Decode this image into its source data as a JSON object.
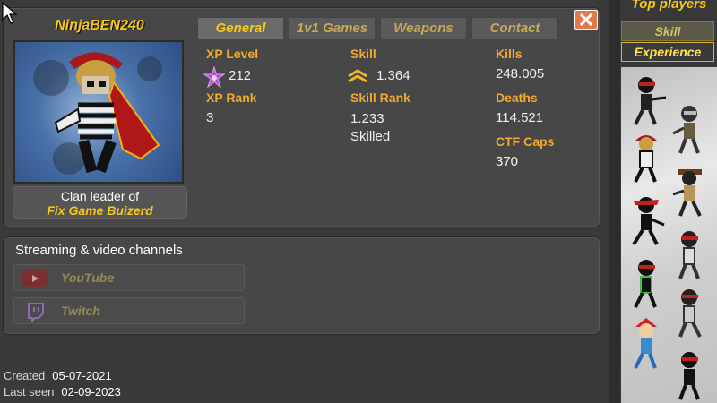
{
  "profile": {
    "username": "NinjaBEN240",
    "clan_label": "Clan leader of",
    "clan_name": "Fix Game Buizerd"
  },
  "tabs": [
    {
      "label": "General",
      "active": true
    },
    {
      "label": "1v1 Games",
      "active": false
    },
    {
      "label": "Weapons",
      "active": false
    },
    {
      "label": "Contact",
      "active": false
    }
  ],
  "stats": {
    "xp_level_label": "XP Level",
    "xp_level_value": "212",
    "xp_rank_label": "XP Rank",
    "xp_rank_value": "3",
    "skill_label": "Skill",
    "skill_value": "1.364",
    "skill_rank_label": "Skill Rank",
    "skill_rank_value": "1.233",
    "skill_rank_tier": "Skilled",
    "kills_label": "Kills",
    "kills_value": "248.005",
    "deaths_label": "Deaths",
    "deaths_value": "114.521",
    "ctf_label": "CTF Caps",
    "ctf_value": "370"
  },
  "streaming": {
    "title": "Streaming & video channels",
    "youtube_label": "YouTube",
    "twitch_label": "Twitch"
  },
  "footer": {
    "created_label": "Created",
    "created_value": "05-07-2021",
    "last_seen_label": "Last seen",
    "last_seen_value": "02-09-2023"
  },
  "sidebar": {
    "title": "Top players",
    "sort_skill": "Skill",
    "sort_experience": "Experience"
  },
  "colors": {
    "accent_gold": "#f6c81a",
    "stat_label_orange": "#f2a92c",
    "close_button": "#e07a4b",
    "xp_star": "#b04fd0"
  }
}
